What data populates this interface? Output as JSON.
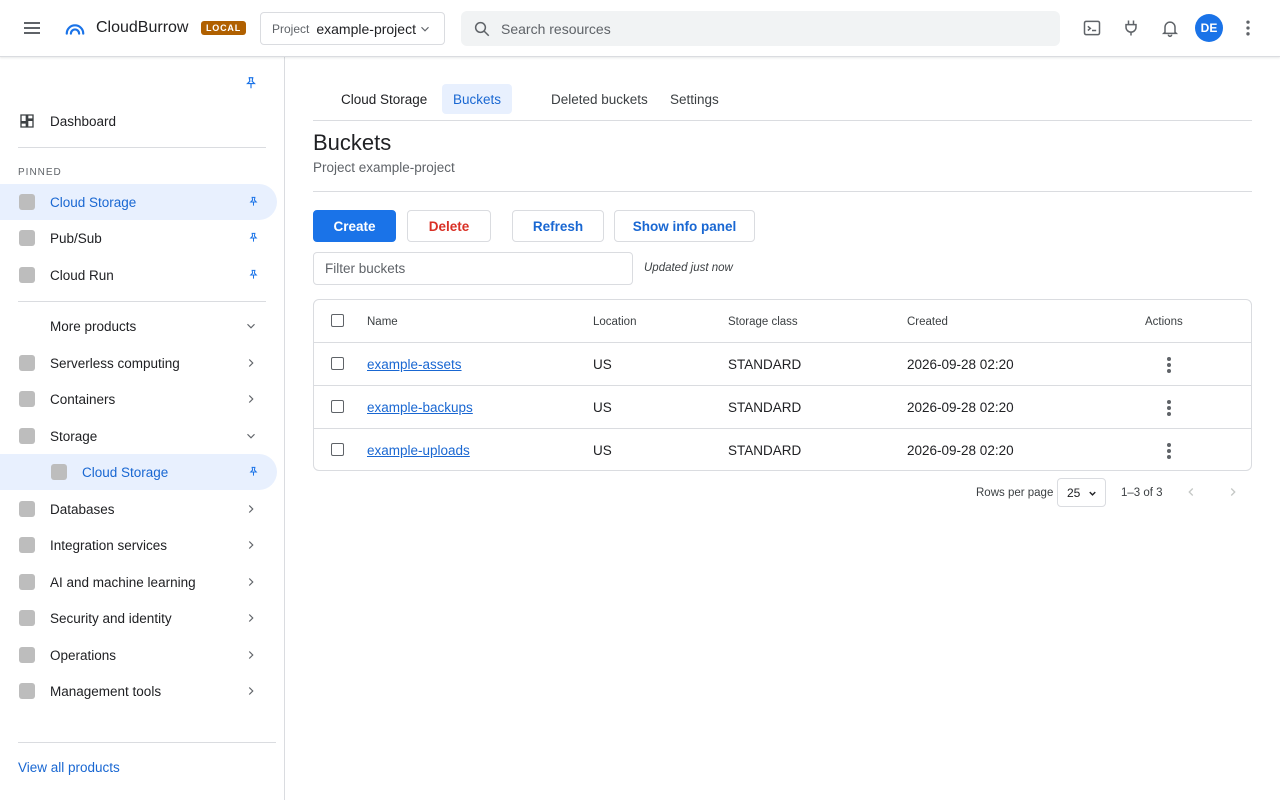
{
  "app": {
    "title": "CloudBurrow",
    "badge": "LOCAL"
  },
  "project": {
    "label": "Project",
    "value": "example-project"
  },
  "search": {
    "placeholder": "Search resources"
  },
  "user": {
    "initials": "DE"
  },
  "colors": {
    "accent": "#1a73e8",
    "badge": "#b06000",
    "danger": "#d93025",
    "active_bg": "#e8f0fe"
  },
  "icons": [
    "hamburger-icon",
    "cloud-logo-icon",
    "chevron-down-icon",
    "search-icon",
    "terminal-icon",
    "plug-icon",
    "bell-icon",
    "more-vert-icon",
    "pin-icon",
    "dashboard-icon",
    "chevron-right-icon",
    "chevron-left-icon"
  ],
  "sidebar": {
    "dashboard": "Dashboard",
    "pinned_label": "PINNED",
    "pinned": [
      {
        "label": "Cloud Storage",
        "active": true
      },
      {
        "label": "Pub/Sub"
      },
      {
        "label": "Cloud Run"
      }
    ],
    "more_products": "More products",
    "categories": [
      {
        "label": "Serverless computing"
      },
      {
        "label": "Containers"
      },
      {
        "label": "Storage",
        "expanded": true
      },
      {
        "label": "Databases"
      },
      {
        "label": "Integration services"
      },
      {
        "label": "AI and machine learning"
      },
      {
        "label": "Security and identity"
      },
      {
        "label": "Operations"
      },
      {
        "label": "Management tools"
      }
    ],
    "storage_child": "Cloud Storage",
    "view_all": "View all products"
  },
  "tabs": {
    "section": "Cloud Storage",
    "items": [
      {
        "label": "Buckets",
        "active": true
      },
      {
        "label": "Deleted buckets"
      },
      {
        "label": "Settings"
      }
    ]
  },
  "page": {
    "title": "Buckets",
    "subtitle": "Project example-project"
  },
  "toolbar": {
    "create": "Create",
    "delete": "Delete",
    "refresh": "Refresh",
    "info_panel": "Show info panel",
    "filter_placeholder": "Filter buckets",
    "updated": "Updated just now"
  },
  "table": {
    "headers": [
      "Name",
      "Location",
      "Storage class",
      "Created",
      "Actions"
    ],
    "rows": [
      {
        "name": "example-assets",
        "location": "US",
        "storage_class": "STANDARD",
        "created": "2026-09-28 02:20"
      },
      {
        "name": "example-backups",
        "location": "US",
        "storage_class": "STANDARD",
        "created": "2026-09-28 02:20"
      },
      {
        "name": "example-uploads",
        "location": "US",
        "storage_class": "STANDARD",
        "created": "2026-09-28 02:20"
      }
    ]
  },
  "pagination": {
    "rows_per_page_label": "Rows per page",
    "rows_per_page": "25",
    "range": "1–3 of 3"
  }
}
